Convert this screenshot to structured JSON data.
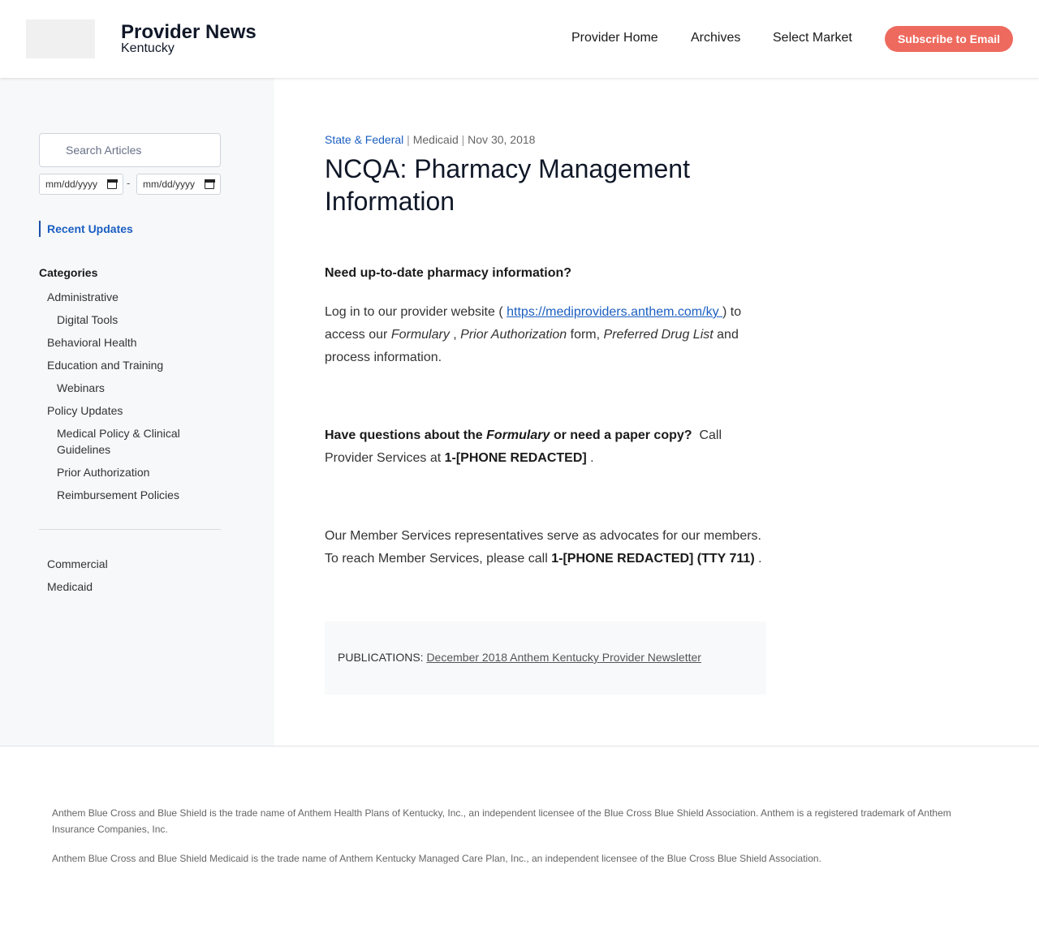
{
  "header": {
    "title": "Provider News",
    "subtitle": "Kentucky",
    "nav": [
      "Provider Home",
      "Archives",
      "Select Market"
    ],
    "subscribe_label": "Subscribe to Email",
    "accent_color": "#ee6a5e"
  },
  "sidebar": {
    "search_placeholder": "Search Articles",
    "search_icon": "search-icon",
    "date_placeholder": "mm/dd/yyyy",
    "date_separator": "-",
    "recent_updates": "Recent Updates",
    "categories_heading": "Categories",
    "categories": [
      "Administrative",
      "Digital Tools",
      "Behavioral Health",
      "Education and Training",
      "Webinars",
      "Policy Updates",
      "Medical Policy & Clinical Guidelines",
      "Prior Authorization",
      "Reimbursement Policies"
    ],
    "lines_of_business": [
      "Commercial",
      "Medicaid"
    ]
  },
  "article": {
    "category": "State & Federal",
    "line_of_business": "Medicaid",
    "date": "Nov 30, 2018",
    "meta_separator": "|",
    "title": "NCQA: Pharmacy Management Information",
    "heading1": "Need up-to-date pharmacy information?",
    "p1_text1": "Log in to our provider website ( ",
    "p1_link": "https://mediproviders.anthem.com/ky ",
    "p1_text2": ") to access our ",
    "p1_em1": "Formulary ",
    "p1_text3": ", ",
    "p1_em2": "Prior Authorization",
    "p1_text4": " form, ",
    "p1_em3": "Preferred Drug List",
    "p1_text5": " and process information.",
    "p2_bold1": "Have questions about the ",
    "p2_bold_em": "Formulary",
    "p2_bold2": " or need a paper copy?",
    "p2_text1": "  Call Provider Services at ",
    "p2_phone": "1-[PHONE REDACTED] ",
    "p2_text2": ".",
    "p3_text1": "Our Member Services representatives serve as advocates for our members. To reach Member Services, please call ",
    "p3_phone": "1-[PHONE REDACTED] (TTY 711) ",
    "p3_text2": ".",
    "publications_label": "PUBLICATIONS:",
    "publication_link": "December 2018 Anthem Kentucky Provider Newsletter",
    "link_color": "#1b5fc1"
  },
  "footer": {
    "line1": "Anthem Blue Cross and Blue Shield is the trade name of Anthem Health Plans of Kentucky, Inc., an independent licensee of the Blue Cross Blue Shield Association. Anthem is a registered trademark of Anthem Insurance Companies, Inc.",
    "line2": "Anthem Blue Cross and Blue Shield Medicaid is the trade name of Anthem Kentucky Managed Care Plan, Inc., an independent licensee of the Blue Cross Blue Shield Association."
  }
}
